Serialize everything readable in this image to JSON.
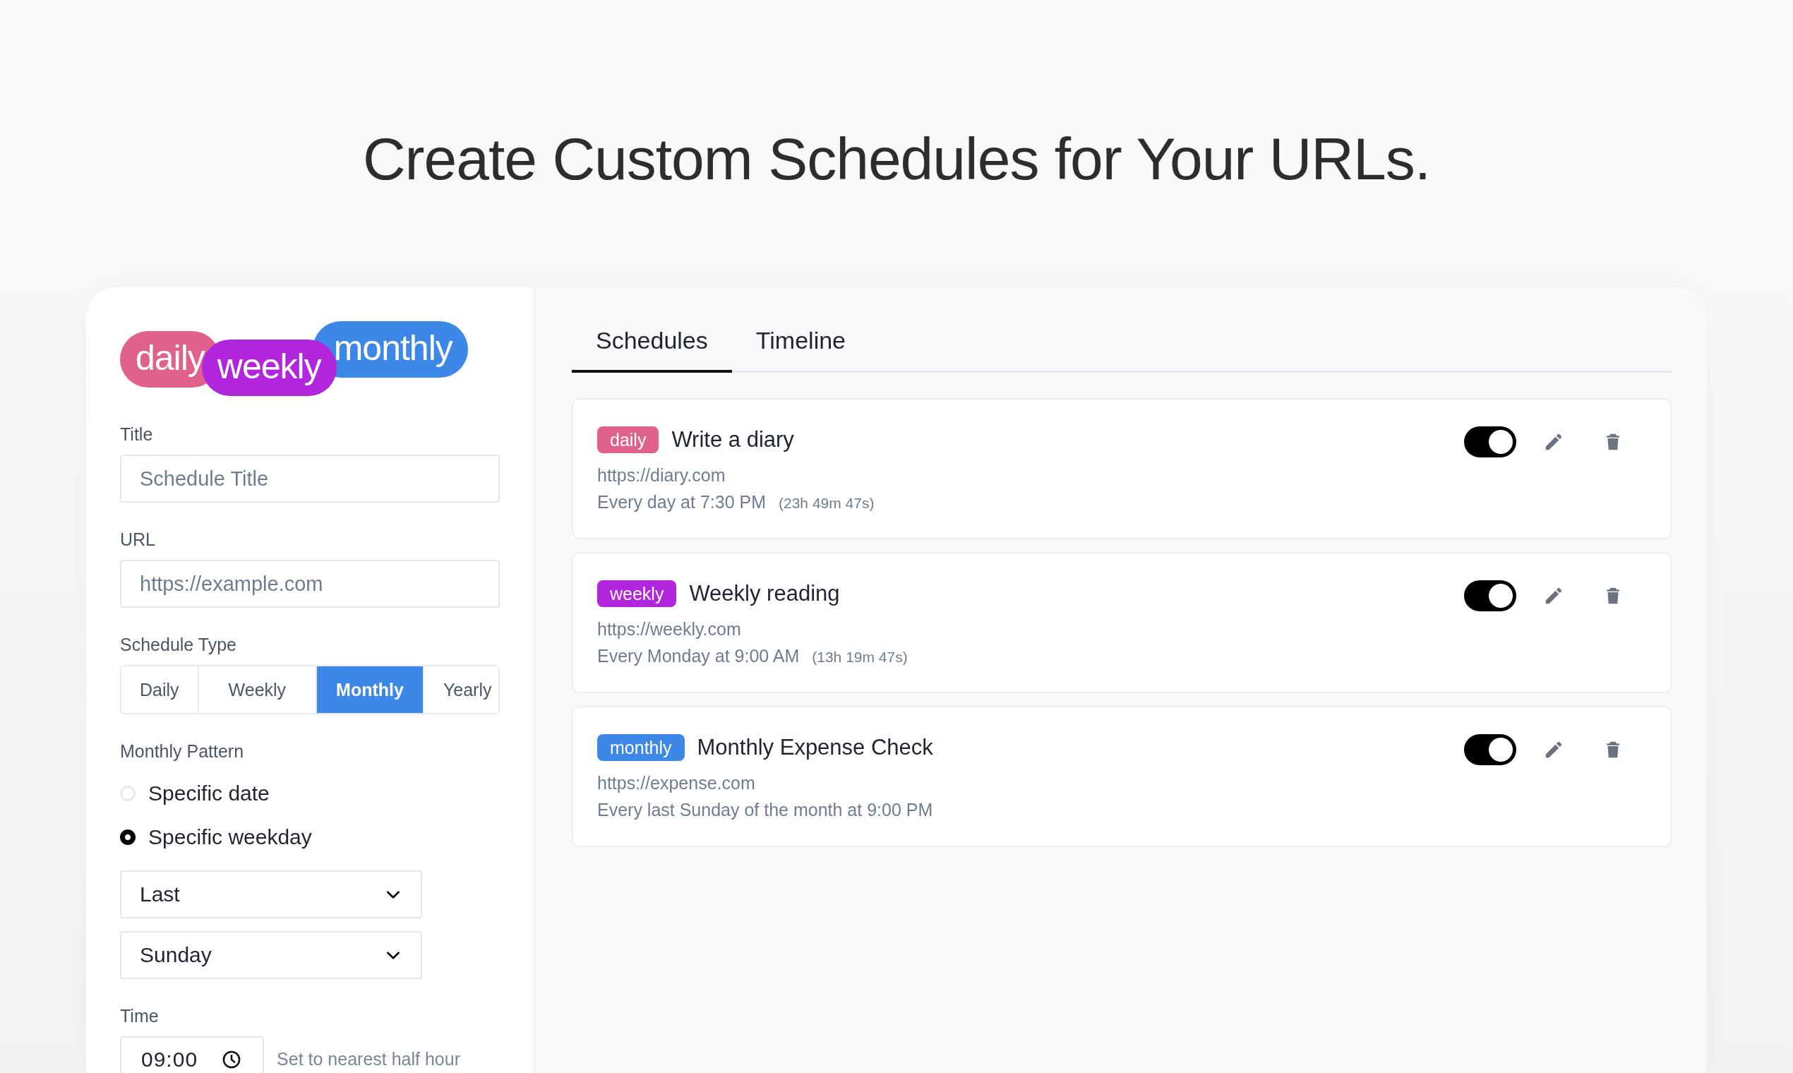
{
  "heading": "Create Custom Schedules for Your URLs.",
  "logo": [
    {
      "text": "daily",
      "color": "#e0628c"
    },
    {
      "text": "weekly",
      "color": "#b125dc"
    },
    {
      "text": "monthly",
      "color": "#3d87e8"
    }
  ],
  "form": {
    "title": {
      "label": "Title",
      "placeholder": "Schedule Title"
    },
    "url": {
      "label": "URL",
      "placeholder": "https://example.com"
    },
    "schedule_type": {
      "label": "Schedule Type",
      "options": [
        {
          "label": "Daily",
          "selected": false
        },
        {
          "label": "Weekly",
          "selected": false
        },
        {
          "label": "Monthly",
          "selected": true
        },
        {
          "label": "Yearly",
          "selected": false
        }
      ]
    },
    "monthly_pattern": {
      "label": "Monthly Pattern",
      "options": [
        {
          "label": "Specific date",
          "selected": false
        },
        {
          "label": "Specific weekday",
          "selected": true
        }
      ]
    },
    "selects": [
      {
        "value": "Last"
      },
      {
        "value": "Sunday"
      }
    ],
    "time": {
      "label": "Time",
      "value": "09:00",
      "hint": "Set to nearest half hour"
    }
  },
  "tabs": [
    {
      "label": "Schedules",
      "selected": true
    },
    {
      "label": "Timeline",
      "selected": false
    }
  ],
  "schedules": [
    {
      "tag": "daily",
      "color": "#e0628c",
      "title": "Write a diary",
      "url": "https://diary.com",
      "when": "Every day at 7:30 PM",
      "countdown": "(23h 49m 47s)",
      "on": true
    },
    {
      "tag": "weekly",
      "color": "#b125dc",
      "title": "Weekly reading",
      "url": "https://weekly.com",
      "when": "Every Monday at 9:00 AM",
      "countdown": "(13h 19m 47s)",
      "on": true
    },
    {
      "tag": "monthly",
      "color": "#3d87e8",
      "title": "Monthly Expense Check",
      "url": "https://expense.com",
      "when": "Every last Sunday of the month at 9:00 PM",
      "on": true
    }
  ]
}
